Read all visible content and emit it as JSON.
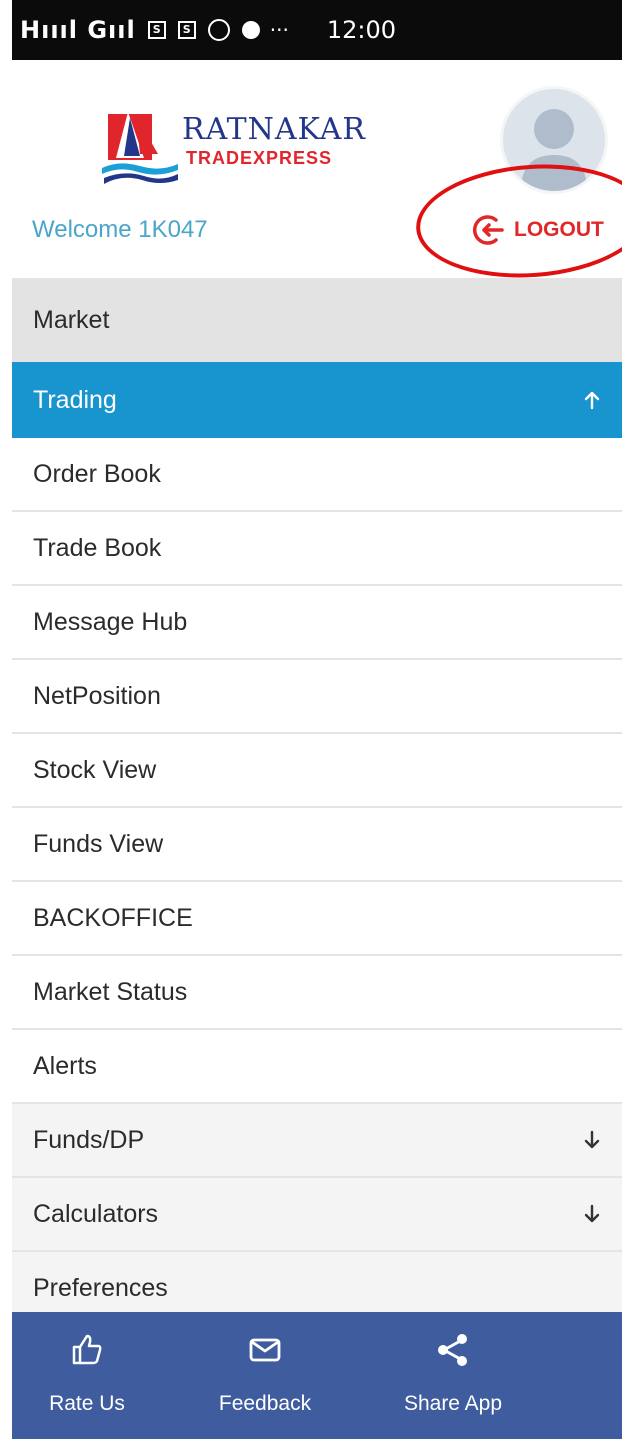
{
  "status_bar": {
    "signals": "Hıııl Gııl",
    "icons": [
      "sim-icon",
      "sim-icon",
      "whatsapp-icon",
      "chat-dot-icon"
    ],
    "sim_letter": "S",
    "more": "···",
    "time": "12:00"
  },
  "header": {
    "brand_name": "RATNAKAR",
    "brand_sub": "TRADEXPRESS",
    "welcome": "Welcome 1K047",
    "logout_label": "LOGOUT"
  },
  "menu": [
    {
      "label": "Market",
      "style": "grey",
      "arrow": ""
    },
    {
      "label": "Trading",
      "style": "active",
      "arrow": "up"
    },
    {
      "label": "Order Book",
      "style": "normal",
      "arrow": ""
    },
    {
      "label": "Trade Book",
      "style": "normal",
      "arrow": ""
    },
    {
      "label": "Message Hub",
      "style": "normal",
      "arrow": ""
    },
    {
      "label": "NetPosition",
      "style": "normal",
      "arrow": ""
    },
    {
      "label": "Stock View",
      "style": "normal",
      "arrow": ""
    },
    {
      "label": "Funds View",
      "style": "normal",
      "arrow": ""
    },
    {
      "label": "BACKOFFICE",
      "style": "normal",
      "arrow": ""
    },
    {
      "label": "Market Status",
      "style": "normal",
      "arrow": ""
    },
    {
      "label": "Alerts",
      "style": "normal",
      "arrow": ""
    },
    {
      "label": "Funds/DP",
      "style": "light",
      "arrow": "down"
    },
    {
      "label": "Calculators",
      "style": "light",
      "arrow": "down"
    },
    {
      "label": "Preferences",
      "style": "light",
      "arrow": ""
    }
  ],
  "bottom_bar": {
    "rate_us": "Rate Us",
    "feedback": "Feedback",
    "share_app": "Share App"
  },
  "colors": {
    "accent": "#1895cf",
    "logout_red": "#e02828",
    "bottom_bar": "#3f5c9e",
    "welcome_text": "#4aa6c8"
  }
}
